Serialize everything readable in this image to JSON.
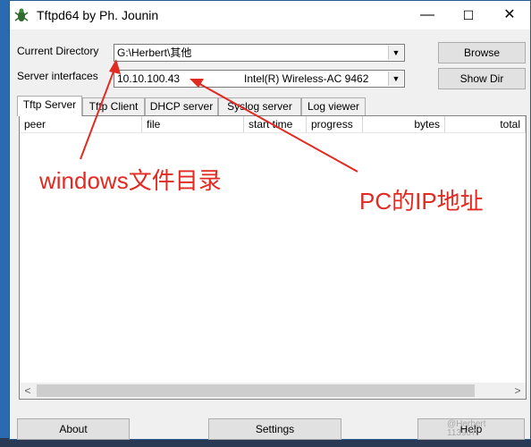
{
  "window": {
    "title": "Tftpd64 by Ph. Jounin",
    "icon": "bug-icon"
  },
  "controls": {
    "minimize": "—",
    "maximize": "☐",
    "close": "✕",
    "current_directory_label": "Current Directory",
    "current_directory_value": "G:\\Herbert\\其他",
    "server_interfaces_label": "Server interfaces",
    "server_ip": "10.10.100.43",
    "server_adapter": "Intel(R) Wireless-AC 9462",
    "browse_label": "Browse",
    "show_dir_label": "Show Dir"
  },
  "tabs": [
    "Tftp Server",
    "Tftp Client",
    "DHCP server",
    "Syslog server",
    "Log viewer"
  ],
  "active_tab": "Tftp Server",
  "table": {
    "columns": [
      "peer",
      "file",
      "start time",
      "progress",
      "bytes",
      "total"
    ],
    "rows": []
  },
  "footer": {
    "about_label": "About",
    "settings_label": "Settings",
    "help_label": "Help"
  },
  "annotations": {
    "dir_note": "windows文件目录",
    "ip_note": "PC的IP地址",
    "color": "#e12a22"
  },
  "watermark": {
    "line1": "@Herbert",
    "line2": "113907"
  }
}
